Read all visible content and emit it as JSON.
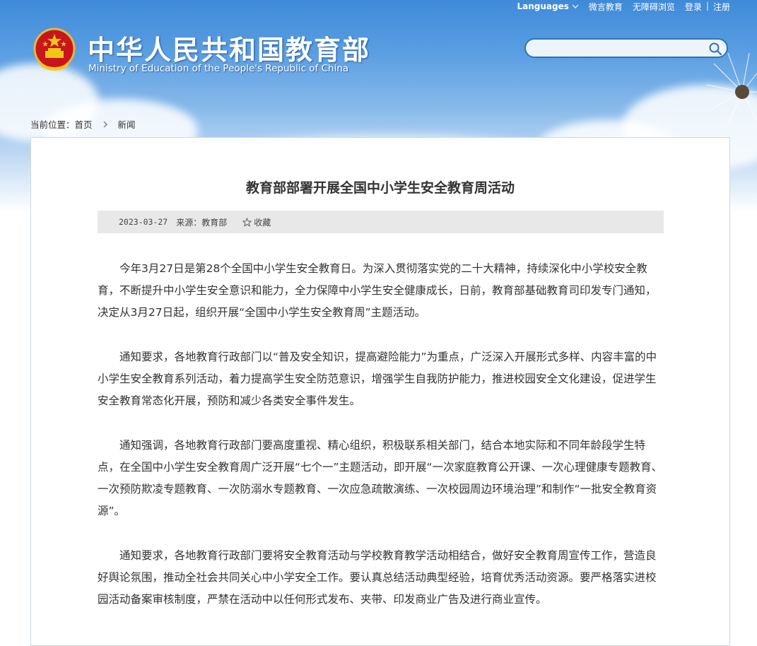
{
  "header": {
    "top_links": {
      "languages": "Languages",
      "weibo": "微言教育",
      "accessible": "无障碍浏览",
      "login": "登录",
      "divider": "|",
      "register": "注册"
    },
    "title_cn": "中华人民共和国教育部",
    "title_en": "Ministry of Education of the People's Republic of China",
    "search": {
      "placeholder": ""
    }
  },
  "breadcrumb": {
    "prefix": "当前位置：",
    "home": "首页",
    "current": "新闻"
  },
  "article": {
    "title": "教育部部署开展全国中小学生安全教育周活动",
    "date": "2023-03-27",
    "source": "来源：教育部",
    "favorite": "收藏",
    "paragraphs": [
      "今年3月27日是第28个全国中小学生安全教育日。为深入贯彻落实党的二十大精神，持续深化中小学校安全教育，不断提升中小学生安全意识和能力，全力保障中小学生安全健康成长，日前，教育部基础教育司印发专门通知，决定从3月27日起，组织开展“全国中小学生安全教育周”主题活动。",
      "通知要求，各地教育行政部门以“普及安全知识，提高避险能力”为重点，广泛深入开展形式多样、内容丰富的中小学生安全教育系列活动，着力提高学生安全防范意识，增强学生自我防护能力，推进校园安全文化建设，促进学生安全教育常态化开展，预防和减少各类安全事件发生。",
      "通知强调，各地教育行政部门要高度重视、精心组织，积极联系相关部门，结合本地实际和不同年龄段学生特点，在全国中小学生安全教育周广泛开展“七个一”主题活动，即开展“一次家庭教育公开课、一次心理健康专题教育、一次预防欺凌专题教育、一次防溺水专题教育、一次应急疏散演练、一次校园周边环境治理”和制作“一批安全教育资源”。",
      "通知要求，各地教育行政部门要将安全教育活动与学校教育教学活动相结合，做好安全教育周宣传工作，营造良好舆论氛围，推动全社会共同关心中小学安全工作。要认真总结活动典型经验，培育优秀活动资源。要严格落实进校园活动备案审核制度，严禁在活动中以任何形式发布、夹带、印发商业广告及进行商业宣传。"
    ]
  }
}
